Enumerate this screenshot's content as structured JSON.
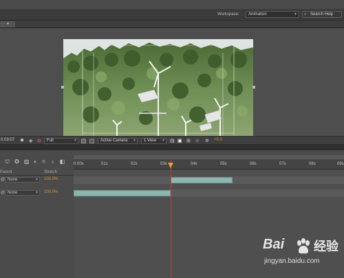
{
  "header": {
    "workspace_label": "Workspace:",
    "workspace_value": "Animation",
    "search_placeholder": "Search Help"
  },
  "viewer_toolbar": {
    "timecode": "0:03:07",
    "resolution": "Full",
    "camera": "Active Camera",
    "view_count": "1 View",
    "exposure": "+0.0"
  },
  "timeline": {
    "ruler_labels": [
      "0:00s",
      "01s",
      "02s",
      "03s",
      "04s",
      "05s",
      "06s",
      "07s",
      "08s",
      "09s"
    ],
    "columns": {
      "parent": "Parent",
      "stretch": "Stretch"
    },
    "layers": [
      {
        "parent": "None",
        "stretch": "100.0%",
        "bar_start": 0.36,
        "bar_end": 0.59
      },
      {
        "parent": "None",
        "stretch": "100.0%",
        "bar_start": 0.0,
        "bar_end": 0.36
      }
    ],
    "playhead_time_fraction": 0.36
  },
  "watermark": {
    "brand_latin": "Bai",
    "brand_cn": "经验",
    "url": "jingyan.baidu.com"
  },
  "colors": {
    "accent_orange": "#d79b2a",
    "playhead_red": "#d23a2e",
    "layer_bar": "#8fb5b0"
  }
}
